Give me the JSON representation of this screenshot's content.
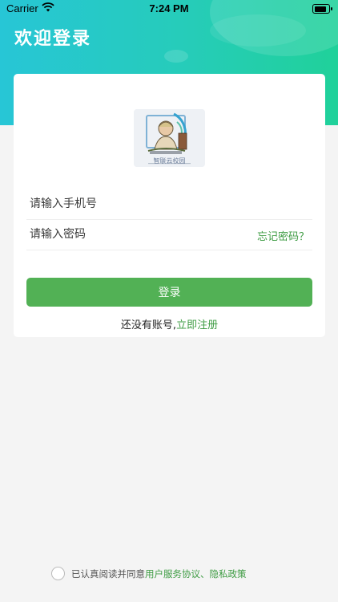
{
  "status_bar": {
    "carrier": "Carrier",
    "time": "7:24 PM",
    "battery_level": 0.85
  },
  "header": {
    "title": "欢迎登录"
  },
  "logo": {
    "caption": "智联云校园"
  },
  "form": {
    "phone_placeholder": "请输入手机号",
    "password_placeholder": "请输入密码",
    "forgot_label": "忘记密码？",
    "login_label": "登录",
    "register_prefix": "还没有账号,",
    "register_link": "立即注册"
  },
  "agreement": {
    "prefix": "已认真阅读并同意 ",
    "user_agreement": "用户服务协议",
    "separator": "、",
    "privacy": "隐私政策"
  },
  "colors": {
    "accent_green": "#52b155",
    "header_start": "#27c6d6",
    "header_end": "#20d19a"
  }
}
